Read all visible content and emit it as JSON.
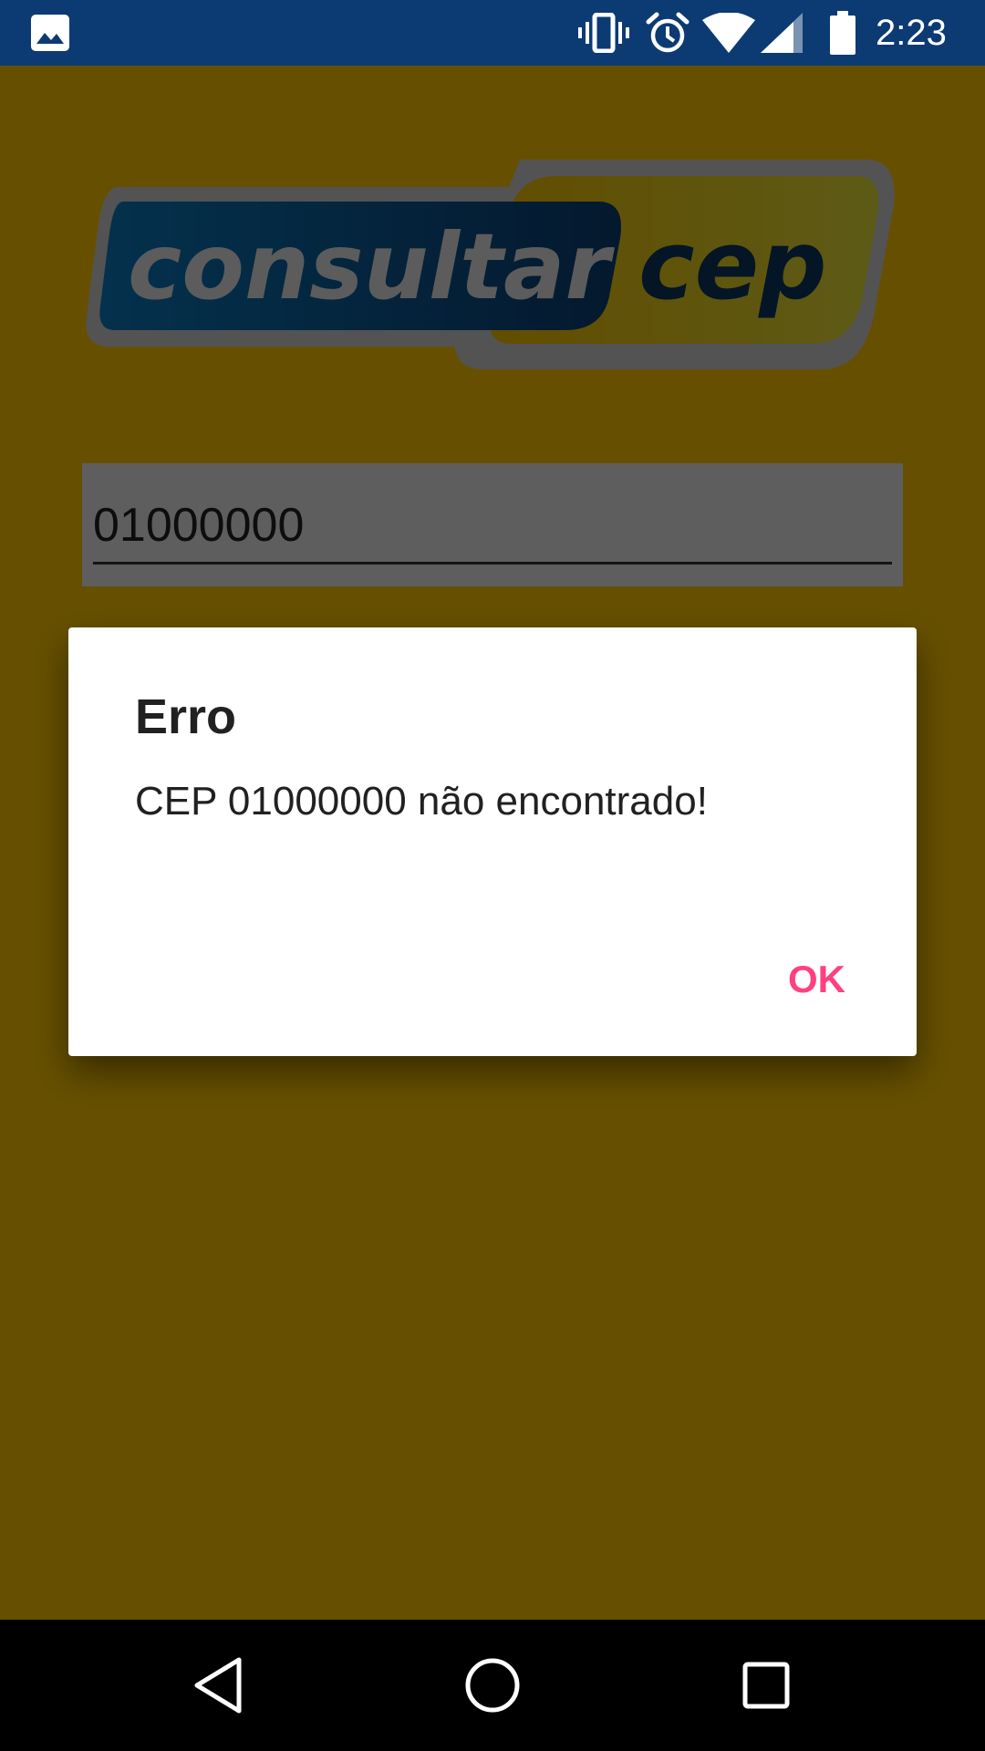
{
  "status_bar": {
    "time": "2:23",
    "icons": [
      "gallery-notification-icon",
      "vibrate-icon",
      "alarm-icon",
      "wifi-icon",
      "cell-signal-icon",
      "battery-icon"
    ],
    "background_color": "#0C3B73"
  },
  "app": {
    "background_color": "#FFC800",
    "logo": {
      "word_left": "consultar",
      "word_right": "cep"
    },
    "cep_input": {
      "value": "01000000"
    }
  },
  "dialog": {
    "title": "Erro",
    "message": "CEP 01000000 não encontrado!",
    "ok_label": "OK",
    "accent_color": "#FF4081"
  },
  "nav_bar": {
    "icons": [
      "back-icon",
      "home-icon",
      "recents-icon"
    ]
  }
}
